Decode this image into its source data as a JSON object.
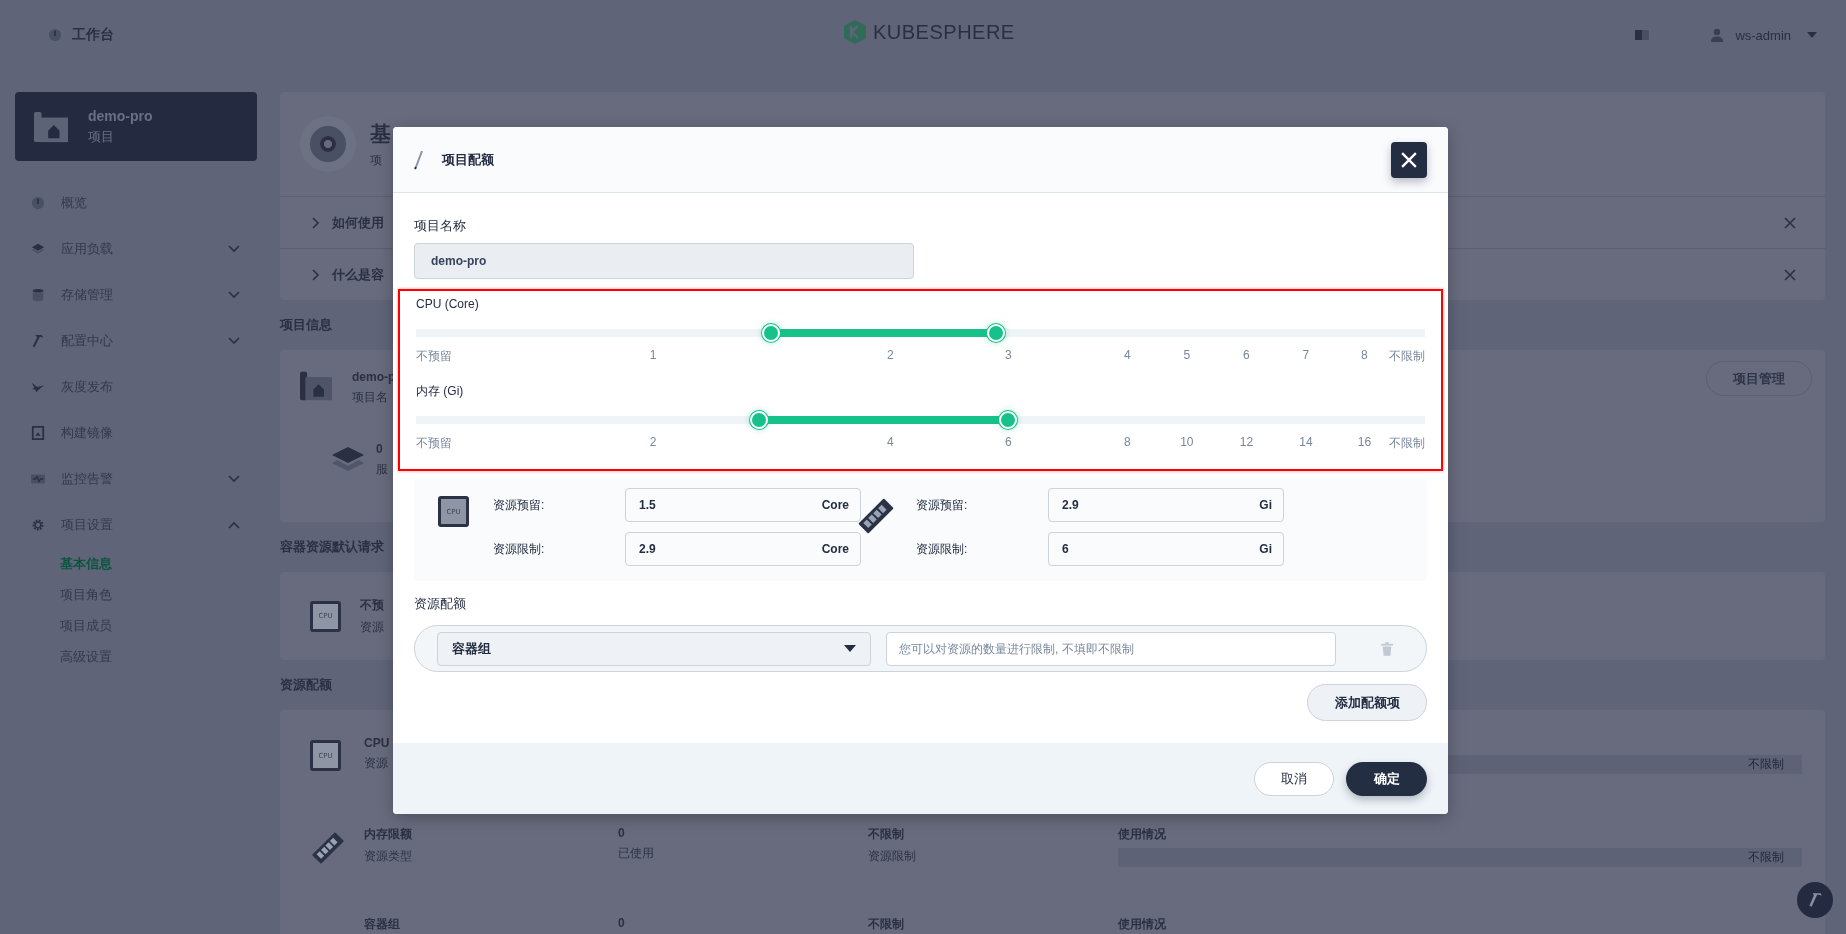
{
  "header": {
    "title": "工作台",
    "brand": "KUBESPHERE",
    "user": "ws-admin"
  },
  "sidebar": {
    "project": {
      "name": "demo-pro",
      "type": "项目"
    },
    "items": [
      {
        "label": "概览",
        "kind": "link"
      },
      {
        "label": "应用负载",
        "kind": "group",
        "expanded": false
      },
      {
        "label": "存储管理",
        "kind": "group",
        "expanded": false
      },
      {
        "label": "配置中心",
        "kind": "group",
        "expanded": false
      },
      {
        "label": "灰度发布",
        "kind": "link"
      },
      {
        "label": "构建镜像",
        "kind": "link"
      },
      {
        "label": "监控告警",
        "kind": "group",
        "expanded": false
      },
      {
        "label": "项目设置",
        "kind": "group",
        "expanded": true,
        "children": [
          {
            "label": "基本信息",
            "selected": true
          },
          {
            "label": "项目角色",
            "selected": false
          },
          {
            "label": "项目成员",
            "selected": false
          },
          {
            "label": "高级设置",
            "selected": false
          }
        ]
      }
    ]
  },
  "page": {
    "title": "基",
    "subtitle": "项",
    "tips": [
      "如何使用",
      "什么是容"
    ],
    "info_heading": "项目信息",
    "info": {
      "name": "demo-p",
      "name_label": "项目名",
      "count": "0",
      "count_label": "服",
      "manage_button": "项目管理"
    },
    "defaults_heading": "容器资源默认请求",
    "defaults": {
      "chip": "CPU",
      "value": "不预",
      "label": "资源"
    },
    "quota_heading": "资源配额",
    "quotas": [
      {
        "kind": "cpu",
        "chip": "CPU",
        "name": "CPU",
        "type": "资源",
        "bar_label": "不限制"
      },
      {
        "kind": "memory",
        "name": "内存限额",
        "type": "资源类型",
        "used": "0",
        "used_label": "已使用",
        "limit": "不限制",
        "limit_label": "资源限制",
        "usage_heading": "使用情况",
        "bar_label": "不限制"
      },
      {
        "kind": "pods",
        "name": "容器组",
        "used": "0",
        "limit": "不限制",
        "usage_heading": "使用情况"
      }
    ]
  },
  "dialog": {
    "title": "项目配额",
    "name_label": "项目名称",
    "name_value": "demo-pro",
    "sliders": [
      {
        "label": "CPU (Core)",
        "thumbs": [
          {
            "level": 0.352
          },
          {
            "level": 0.575
          }
        ],
        "ticks": [
          "不预留",
          "1",
          "2",
          "3",
          "4",
          "5",
          "6",
          "7",
          "8",
          "不限制"
        ]
      },
      {
        "label": "内存 (Gi)",
        "thumbs": [
          {
            "level": 0.34
          },
          {
            "level": 0.587
          }
        ],
        "ticks": [
          "不预留",
          "2",
          "4",
          "6",
          "8",
          "10",
          "12",
          "14",
          "16",
          "不限制"
        ]
      }
    ],
    "resources": [
      {
        "kind": "cpu",
        "chip": "CPU",
        "fields": [
          {
            "label": "资源预留:",
            "value": "1.5",
            "unit": "Core"
          },
          {
            "label": "资源限制:",
            "value": "2.9",
            "unit": "Core"
          }
        ]
      },
      {
        "kind": "memory",
        "fields": [
          {
            "label": "资源预留:",
            "value": "2.9",
            "unit": "Gi"
          },
          {
            "label": "资源限制:",
            "value": "6",
            "unit": "Gi"
          }
        ]
      }
    ],
    "quota_label": "资源配额",
    "quota_items": [
      {
        "type": "容器组",
        "placeholder": "您可以对资源的数量进行限制, 不填即不限制"
      }
    ],
    "add_button": "添加配额项",
    "cancel": "取消",
    "confirm": "确定"
  }
}
